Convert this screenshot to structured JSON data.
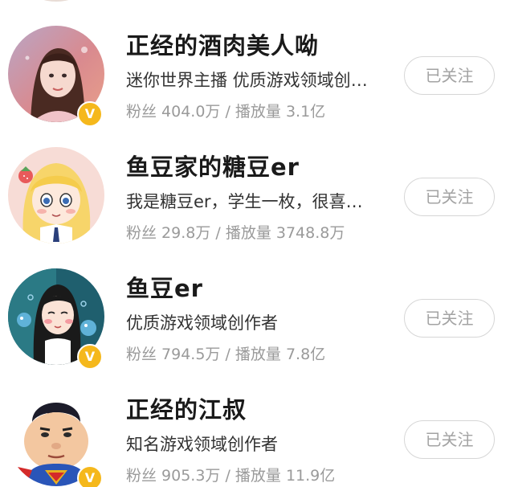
{
  "creators": [
    {
      "name": "正经的酒肉美人呦",
      "desc": "迷你世界主播 优质游戏领域创作者",
      "stats": "粉丝 404.0万 / 播放量 3.1亿",
      "follow_label": "已关注",
      "verified": true,
      "badge": "V",
      "avatar_icon": "girl-portrait-icon"
    },
    {
      "name": "鱼豆家的糖豆er",
      "desc": "我是糖豆er，学生一枚，很喜欢游戏",
      "stats": "粉丝 29.8万 / 播放量 3748.8万",
      "follow_label": "已关注",
      "verified": false,
      "avatar_icon": "anime-girl-icon"
    },
    {
      "name": "鱼豆er",
      "desc": "优质游戏领域创作者",
      "stats": "粉丝 794.5万 / 播放量 7.8亿",
      "follow_label": "已关注",
      "verified": true,
      "badge": "V",
      "avatar_icon": "cartoon-girl-icon"
    },
    {
      "name": "正经的江叔",
      "desc": "知名游戏领域创作者",
      "stats": "粉丝 905.3万 / 播放量 11.9亿",
      "follow_label": "已关注",
      "verified": true,
      "badge": "V",
      "avatar_icon": "superman-caricature-icon"
    }
  ],
  "colors": {
    "badge": "#f5b81c",
    "name": "#1a1a1a",
    "stats": "#9a9a9a",
    "button_border": "#d6d6d6",
    "button_text": "#a3a3a3"
  }
}
